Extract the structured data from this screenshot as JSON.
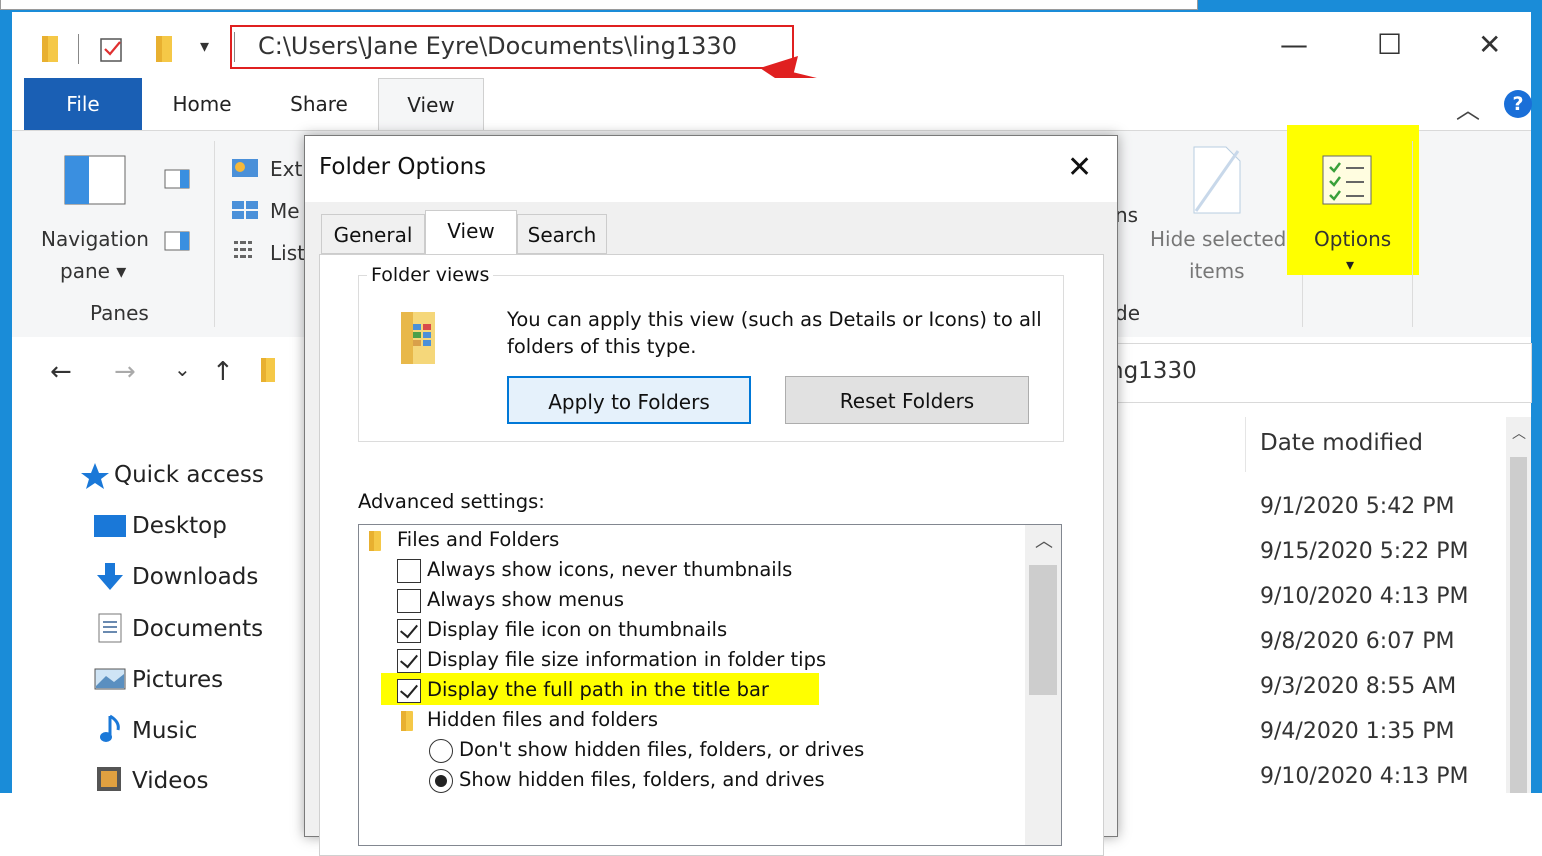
{
  "titlebar": {
    "path": "C:\\Users\\Jane Eyre\\Documents\\ling1330",
    "minimize": "—",
    "maximize": "☐",
    "close": "✕",
    "qa_dropdown": "▾"
  },
  "ribbon_tabs": [
    {
      "label": "File"
    },
    {
      "label": "Home"
    },
    {
      "label": "Share"
    },
    {
      "label": "View"
    }
  ],
  "ribbon": {
    "navigation_pane": "Navigation",
    "navigation_pane_2": "pane",
    "panes_group": "Panes",
    "layout_items": [
      "Extr",
      "Me",
      "List"
    ],
    "hidden_ns": "ns",
    "hidden_de": "de",
    "hide_selected_1": "Hide selected",
    "hide_selected_2": "items",
    "options": "Options",
    "options_arrow": "▾",
    "collapse": "︿",
    "help": "?"
  },
  "nav": {
    "back": "←",
    "forward": "→",
    "recent": "⌄",
    "up": "↑",
    "address_tail": "ng1330"
  },
  "sidebar": [
    {
      "label": "Quick access"
    },
    {
      "label": "Desktop"
    },
    {
      "label": "Downloads"
    },
    {
      "label": "Documents"
    },
    {
      "label": "Pictures"
    },
    {
      "label": "Music"
    },
    {
      "label": "Videos"
    }
  ],
  "file_list": {
    "date_header": "Date modified",
    "dates": [
      "9/1/2020 5:42 PM",
      "9/15/2020 5:22 PM",
      "9/10/2020 4:13 PM",
      "9/8/2020 6:07 PM",
      "9/3/2020 8:55 AM",
      "9/4/2020 1:35 PM",
      "9/10/2020 4:13 PM"
    ]
  },
  "dialog": {
    "title": "Folder Options",
    "close": "✕",
    "tabs": [
      {
        "label": "General"
      },
      {
        "label": "View"
      },
      {
        "label": "Search"
      }
    ],
    "folder_views_legend": "Folder views",
    "folder_views_text": "You can apply this view (such as Details or Icons) to all folders of this type.",
    "apply_button": "Apply to Folders",
    "reset_button": "Reset Folders",
    "advanced_label": "Advanced settings:",
    "tree": {
      "files_and_folders": "Files and Folders",
      "items": [
        {
          "label": "Always show icons, never thumbnails",
          "checked": false
        },
        {
          "label": "Always show menus",
          "checked": false
        },
        {
          "label": "Display file icon on thumbnails",
          "checked": true
        },
        {
          "label": "Display file size information in folder tips",
          "checked": true
        },
        {
          "label": "Display the full path in the title bar",
          "checked": true
        }
      ],
      "hidden_group": "Hidden files and folders",
      "radios": [
        {
          "label": "Don't show hidden files, folders, or drives",
          "selected": false
        },
        {
          "label": "Show hidden files, folders, and drives",
          "selected": true
        }
      ],
      "scroll_up": "︿"
    }
  },
  "colors": {
    "accent": "#1a5fb4",
    "highlight": "#ffff00",
    "annotation_red": "#e02020"
  }
}
